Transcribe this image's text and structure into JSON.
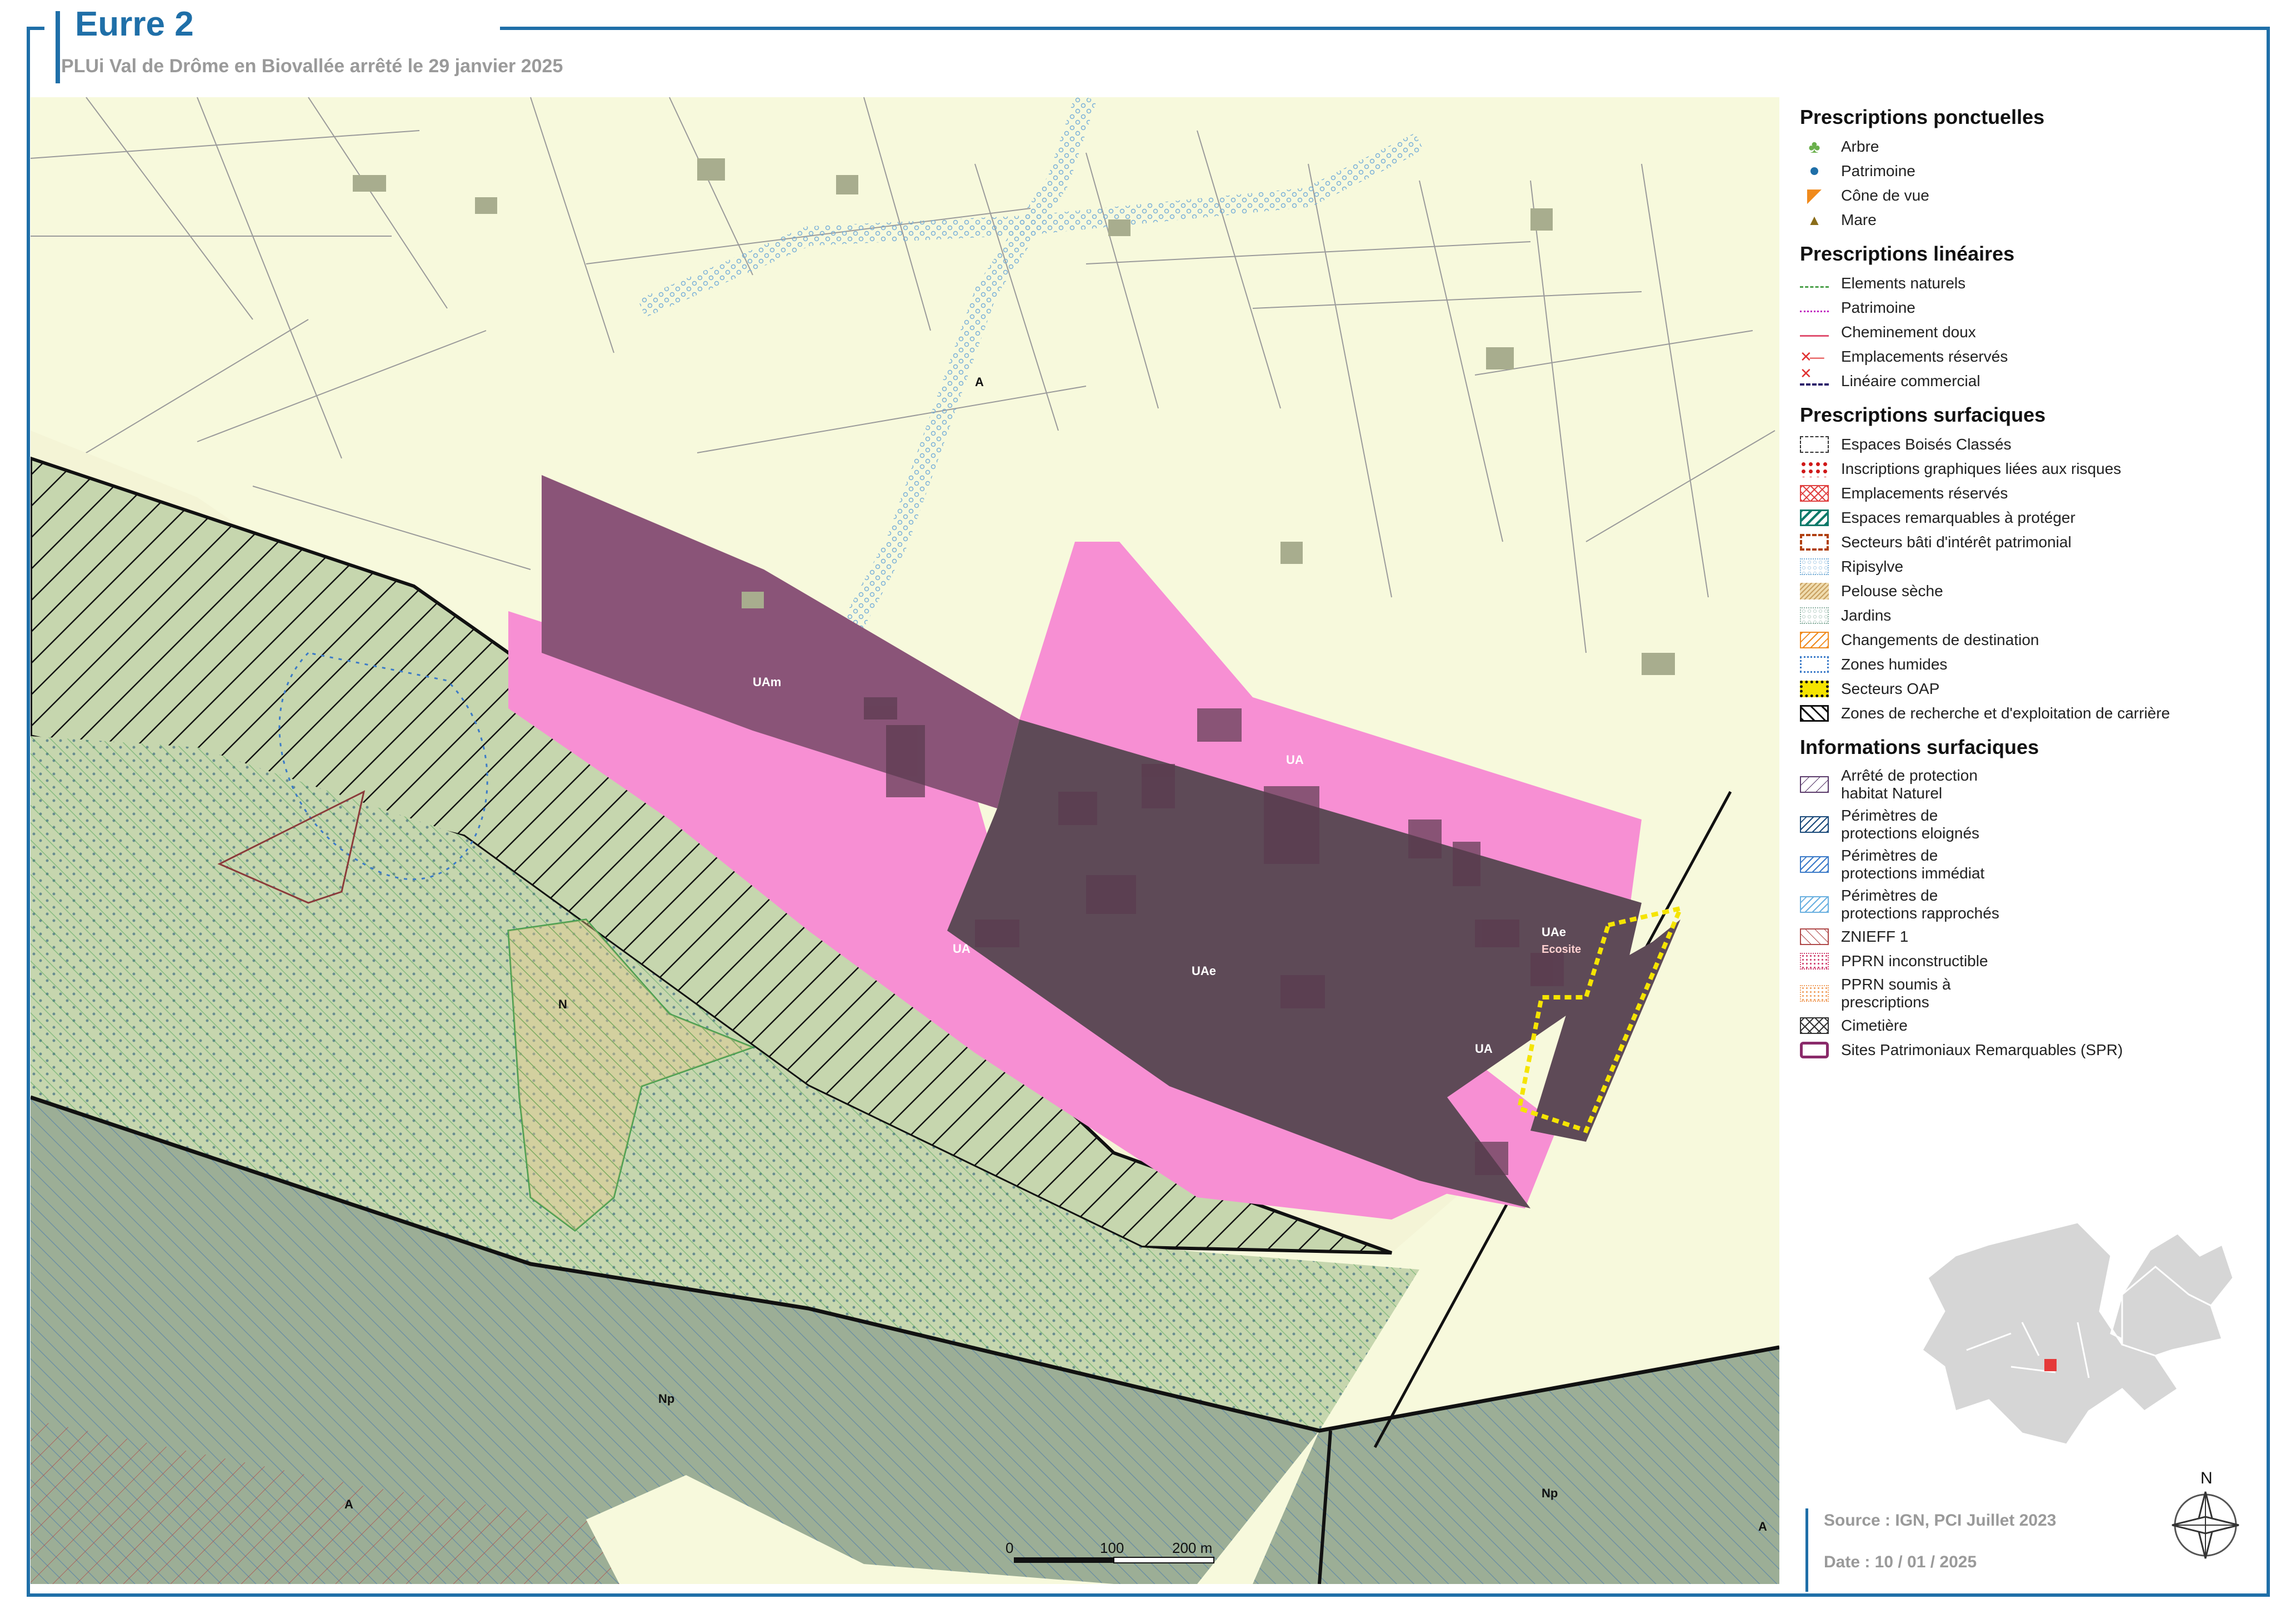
{
  "header": {
    "title": "Eurre 2",
    "subtitle": "PLUi Val de Drôme en Biovallée arrêté le 29 janvier 2025"
  },
  "map": {
    "zone_labels": [
      "A",
      "UAm",
      "UA",
      "UA",
      "UAe",
      "UAe",
      "UA",
      "N",
      "Np",
      "Np",
      "A",
      "A"
    ],
    "oap_label": "Ecosite",
    "scale": {
      "labels": [
        "0",
        "100",
        "200 m"
      ]
    }
  },
  "legend": {
    "ponctuelles": {
      "title": "Prescriptions ponctuelles",
      "items": [
        {
          "label": "Arbre",
          "icon": "tree-icon"
        },
        {
          "label": "Patrimoine",
          "icon": "dot-icon"
        },
        {
          "label": "Cône de vue",
          "icon": "cone-icon"
        },
        {
          "label": "Mare",
          "icon": "triangle-icon"
        }
      ]
    },
    "lineaires": {
      "title": "Prescriptions linéaires",
      "items": [
        {
          "label": "Elements naturels"
        },
        {
          "label": "Patrimoine"
        },
        {
          "label": "Cheminement doux"
        },
        {
          "label": "Emplacements réservés"
        },
        {
          "label": "Linéaire commercial"
        }
      ]
    },
    "surfaciques": {
      "title": "Prescriptions surfaciques",
      "items": [
        {
          "label": "Espaces Boisés Classés"
        },
        {
          "label": "Inscriptions graphiques liées aux risques"
        },
        {
          "label": "Emplacements réservés"
        },
        {
          "label": "Espaces remarquables à protéger"
        },
        {
          "label": "Secteurs bâti d'intérêt patrimonial"
        },
        {
          "label": "Ripisylve"
        },
        {
          "label": "Pelouse sèche"
        },
        {
          "label": "Jardins"
        },
        {
          "label": "Changements de destination"
        },
        {
          "label": "Zones humides"
        },
        {
          "label": "Secteurs OAP"
        },
        {
          "label": "Zones de recherche et d'exploitation de carrière"
        }
      ]
    },
    "informations": {
      "title": "Informations surfaciques",
      "items": [
        {
          "label1": "Arrêté de protection",
          "label2": "habitat Naturel"
        },
        {
          "label1": "Périmètres de",
          "label2": "protections eloignés"
        },
        {
          "label1": "Périmètres de",
          "label2": "protections immédiat"
        },
        {
          "label1": "Périmètres de",
          "label2": "protections rapprochés"
        },
        {
          "label1": "ZNIEFF 1",
          "label2": ""
        },
        {
          "label1": "PPRN inconstructible",
          "label2": ""
        },
        {
          "label1": "PPRN soumis à",
          "label2": "prescriptions"
        },
        {
          "label1": "Cimetière",
          "label2": ""
        },
        {
          "label1": "Sites Patrimoniaux Remarquables (SPR)",
          "label2": ""
        }
      ]
    }
  },
  "footer": {
    "source": "Source : IGN, PCI Juillet 2023",
    "date": "Date : 10 / 01 / 2025",
    "north": "N"
  },
  "colors": {
    "accent": "#1f6fa8",
    "agricultural": "#f7f9dc",
    "ua": "#f78fd3",
    "uam": "#8a5478",
    "uae": "#5e4a57",
    "natural": "#c6d6ae",
    "np": "#9cae96",
    "river": "#f4f4d6"
  }
}
